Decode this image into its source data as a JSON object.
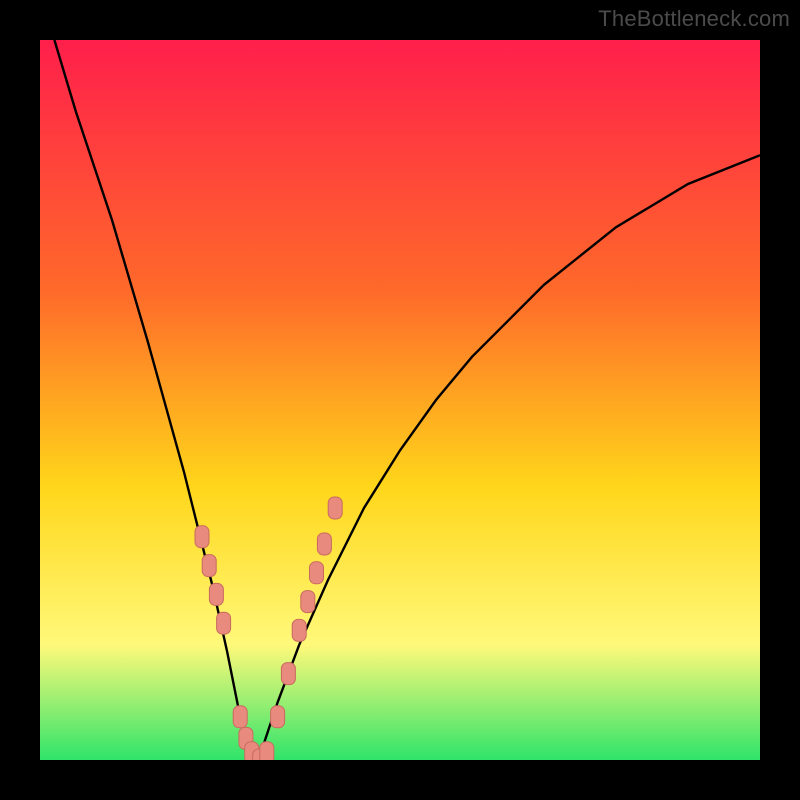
{
  "watermark": "TheBottleneck.com",
  "colors": {
    "bg_black": "#000000",
    "grad_top": "#ff1f4b",
    "grad_mid1": "#ff6a2a",
    "grad_mid2": "#ffd61a",
    "grad_mid3": "#fff97a",
    "grad_bottom": "#2fe46a",
    "curve": "#000000",
    "marker_fill": "#e98a7f",
    "marker_stroke": "#c96a5f"
  },
  "chart_data": {
    "type": "line",
    "title": "",
    "xlabel": "",
    "ylabel": "",
    "xlim": [
      0,
      100
    ],
    "ylim": [
      0,
      100
    ],
    "series": [
      {
        "name": "bottleneck-curve",
        "x": [
          2,
          5,
          10,
          15,
          20,
          22,
          24,
          26,
          27,
          28,
          29,
          30,
          31,
          33,
          36,
          40,
          45,
          50,
          55,
          60,
          65,
          70,
          75,
          80,
          85,
          90,
          95,
          100
        ],
        "values": [
          100,
          90,
          75,
          58,
          40,
          32,
          24,
          15,
          10,
          5,
          2,
          0,
          2,
          8,
          16,
          25,
          35,
          43,
          50,
          56,
          61,
          66,
          70,
          74,
          77,
          80,
          82,
          84
        ]
      }
    ],
    "markers": {
      "name": "highlighted-points",
      "x": [
        22.5,
        23.5,
        24.5,
        25.5,
        27.8,
        28.6,
        29.4,
        30.5,
        31.5,
        33.0,
        34.5,
        36.0,
        37.2,
        38.4,
        39.5,
        41.0
      ],
      "values": [
        31,
        27,
        23,
        19,
        6,
        3,
        1,
        0,
        1,
        6,
        12,
        18,
        22,
        26,
        30,
        35
      ]
    }
  }
}
